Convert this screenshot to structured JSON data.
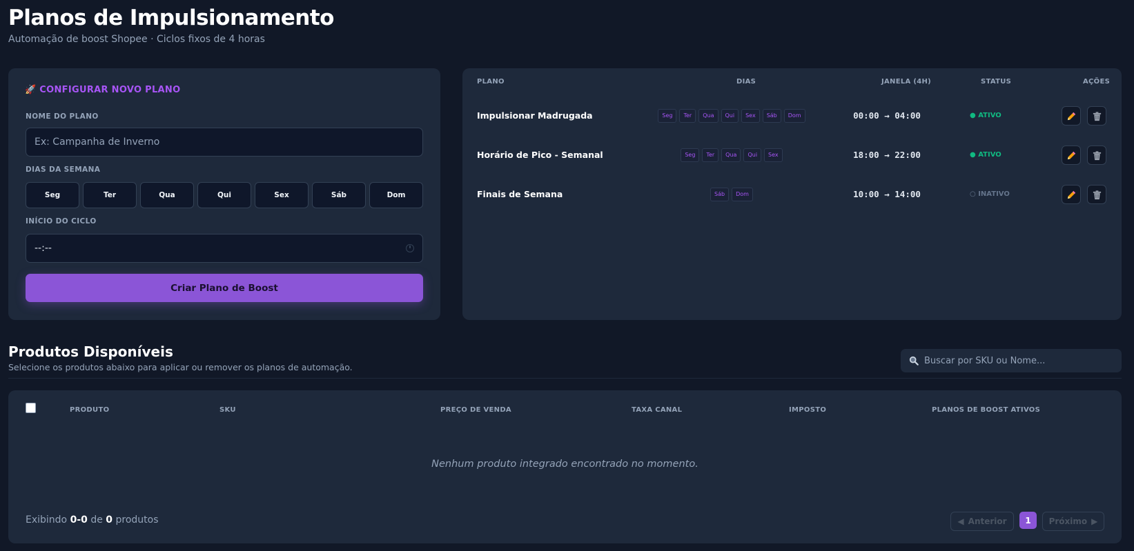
{
  "header": {
    "title": "Planos de Impulsionamento",
    "subtitle": "Automação de boost Shopee · Ciclos fixos de 4 horas"
  },
  "config": {
    "title": "🚀 CONFIGURAR NOVO PLANO",
    "name_label": "NOME DO PLANO",
    "name_placeholder": "Ex: Campanha de Inverno",
    "name_value": "",
    "days_label": "DIAS DA SEMANA",
    "days": [
      "Seg",
      "Ter",
      "Qua",
      "Qui",
      "Sex",
      "Sáb",
      "Dom"
    ],
    "start_label": "INÍCIO DO CICLO",
    "start_value": "--:--",
    "create_button": "Criar Plano de Boost"
  },
  "plans_table": {
    "headers": [
      "PLANO",
      "DIAS",
      "JANELA (4H)",
      "STATUS",
      "AÇÕES"
    ],
    "rows": [
      {
        "name": "Impulsionar Madrugada",
        "days": [
          "Seg",
          "Ter",
          "Qua",
          "Qui",
          "Sex",
          "Sáb",
          "Dom"
        ],
        "window": "00:00 → 04:00",
        "status": "● ATIVO",
        "active": true
      },
      {
        "name": "Horário de Pico - Semanal",
        "days": [
          "Seg",
          "Ter",
          "Qua",
          "Qui",
          "Sex"
        ],
        "window": "18:00 → 22:00",
        "status": "● ATIVO",
        "active": true
      },
      {
        "name": "Finais de Semana",
        "days": [
          "Sáb",
          "Dom"
        ],
        "window": "10:00 → 14:00",
        "status": "○ INATIVO",
        "active": false
      }
    ],
    "edit_icon": "pencil-icon",
    "delete_icon": "trash-icon"
  },
  "products": {
    "title": "Produtos Disponíveis",
    "subtitle": "Selecione os produtos abaixo para aplicar ou remover os planos de automação.",
    "search_placeholder": "Buscar por SKU ou Nome...",
    "headers": [
      "PRODUTO",
      "SKU",
      "PREÇO DE VENDA",
      "TAXA CANAL",
      "IMPOSTO",
      "PLANOS DE BOOST ATIVOS"
    ],
    "empty_message": "Nenhum produto integrado encontrado no momento.",
    "showing_prefix": "Exibindo",
    "showing_range": "0-0",
    "showing_of": "de",
    "showing_total": "0",
    "showing_suffix": "produtos",
    "pagination": {
      "prev": "Anterior",
      "page": "1",
      "next": "Próximo"
    }
  },
  "colors": {
    "background": "#111827",
    "card": "#1e293b",
    "accent": "#8b55d7",
    "active": "#10b981",
    "inactive": "#64748b"
  }
}
